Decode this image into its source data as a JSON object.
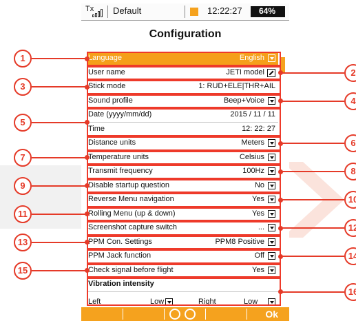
{
  "statusbar": {
    "tx_label": "Tx",
    "model_name": "Default",
    "time": "12:22:27",
    "battery": "64%",
    "battery_level": 0.64
  },
  "title": "Configuration",
  "rows": [
    {
      "label": "Language",
      "value": "English",
      "control": "dropdown",
      "selected": true
    },
    {
      "label": "User name",
      "value": "JETI model",
      "control": "edit"
    },
    {
      "label": "Stick mode",
      "value": "1: RUD+ELE|THR+AIL",
      "control": "none"
    },
    {
      "label": "Sound profile",
      "value": "Beep+Voice",
      "control": "dropdown"
    },
    {
      "label": "Date (yyyy/mm/dd)",
      "value": "2015 / 11 / 11",
      "control": "none"
    },
    {
      "label": "Time",
      "value": "12: 22: 27",
      "control": "none"
    },
    {
      "label": "Distance units",
      "value": "Meters",
      "control": "dropdown"
    },
    {
      "label": "Temperature units",
      "value": "Celsius",
      "control": "dropdown"
    },
    {
      "label": "Transmit frequency",
      "value": "100Hz",
      "control": "dropdown"
    },
    {
      "label": "Disable startup question",
      "value": "No",
      "control": "dropdown"
    },
    {
      "label": "Reverse Menu navigation",
      "value": "Yes",
      "control": "dropdown"
    },
    {
      "label": "Rolling Menu (up & down)",
      "value": "Yes",
      "control": "dropdown"
    },
    {
      "label": "Screenshot capture switch",
      "value": "...",
      "control": "dropdown"
    },
    {
      "label": "PPM Con. Settings",
      "value": "PPM8 Positive",
      "control": "dropdown"
    },
    {
      "label": "PPM Jack function",
      "value": "Off",
      "control": "dropdown"
    },
    {
      "label": "Check signal before flight",
      "value": "Yes",
      "control": "dropdown"
    },
    {
      "label": "Vibration intensity",
      "value": "",
      "control": "none",
      "bold": true
    }
  ],
  "vibration": {
    "left_label": "Left",
    "left_value": "Low",
    "right_label": "Right",
    "right_value": "Low"
  },
  "bottombar": {
    "ok_label": "Ok"
  },
  "callouts": [
    "1",
    "2",
    "3",
    "4",
    "5",
    "6",
    "7",
    "8",
    "9",
    "10",
    "11",
    "12",
    "13",
    "14",
    "15",
    "16"
  ],
  "colors": {
    "accent": "#f5a21e",
    "callout": "#e53a28"
  }
}
